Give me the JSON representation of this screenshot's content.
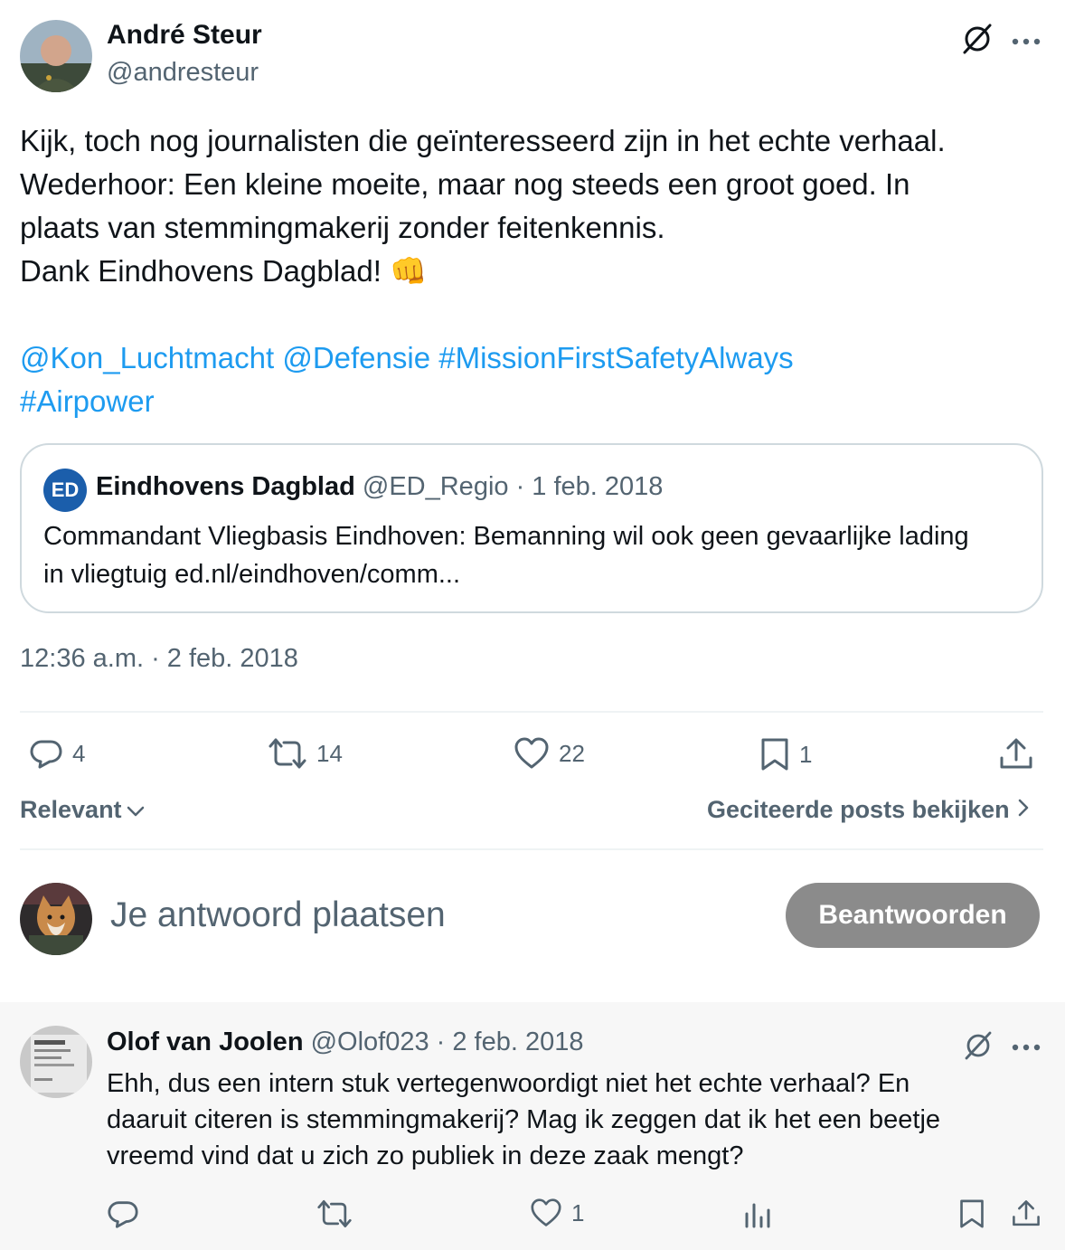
{
  "tweet": {
    "author_name": "André Steur",
    "author_handle": "@andresteur",
    "lines": [
      "Kijk, toch nog journalisten die geïnteresseerd zijn in het echte verhaal.",
      "Wederhoor: Een kleine moeite, maar nog steeds een groot goed.  In",
      "plaats van stemmingmakerij zonder feitenkennis.",
      "Dank Eindhovens Dagblad! 👊"
    ],
    "mentions_line1": "@Kon_Luchtmacht @Defensie #MissionFirstSafetyAlways",
    "mentions_line2": "#Airpower",
    "timestamp": "12:36 a.m. · 2 feb. 2018"
  },
  "quote": {
    "logo_text": "ED",
    "name": "Eindhovens Dagblad",
    "handle_date": "@ED_Regio · 1 feb. 2018",
    "text_line1": "Commandant Vliegbasis Eindhoven: Bemanning wil ook geen gevaarlijke lading",
    "text_line2": "in vliegtuig ed.nl/eindhoven/comm..."
  },
  "actions": {
    "replies": "4",
    "retweets": "14",
    "likes": "22",
    "bookmarks": "1"
  },
  "sort": {
    "label": "Relevant",
    "quotes_link": "Geciteerde posts bekijken"
  },
  "compose": {
    "placeholder": "Je antwoord plaatsen",
    "button": "Beantwoorden"
  },
  "reply": {
    "author_name": "Olof van Joolen",
    "handle_date": "@Olof023 · 2 feb. 2018",
    "lines": [
      "Ehh, dus een intern stuk vertegenwoordigt niet het echte verhaal? En",
      "daaruit citeren is stemmingmakerij? Mag ik zeggen dat ik het een beetje",
      "vreemd vind dat u zich zo publiek in deze zaak mengt?"
    ],
    "likes": "1"
  },
  "colors": {
    "link": "#1d9bf0",
    "muted": "#536471",
    "button_bg": "#8b8b8b",
    "ed_logo": "#1b5eab"
  }
}
